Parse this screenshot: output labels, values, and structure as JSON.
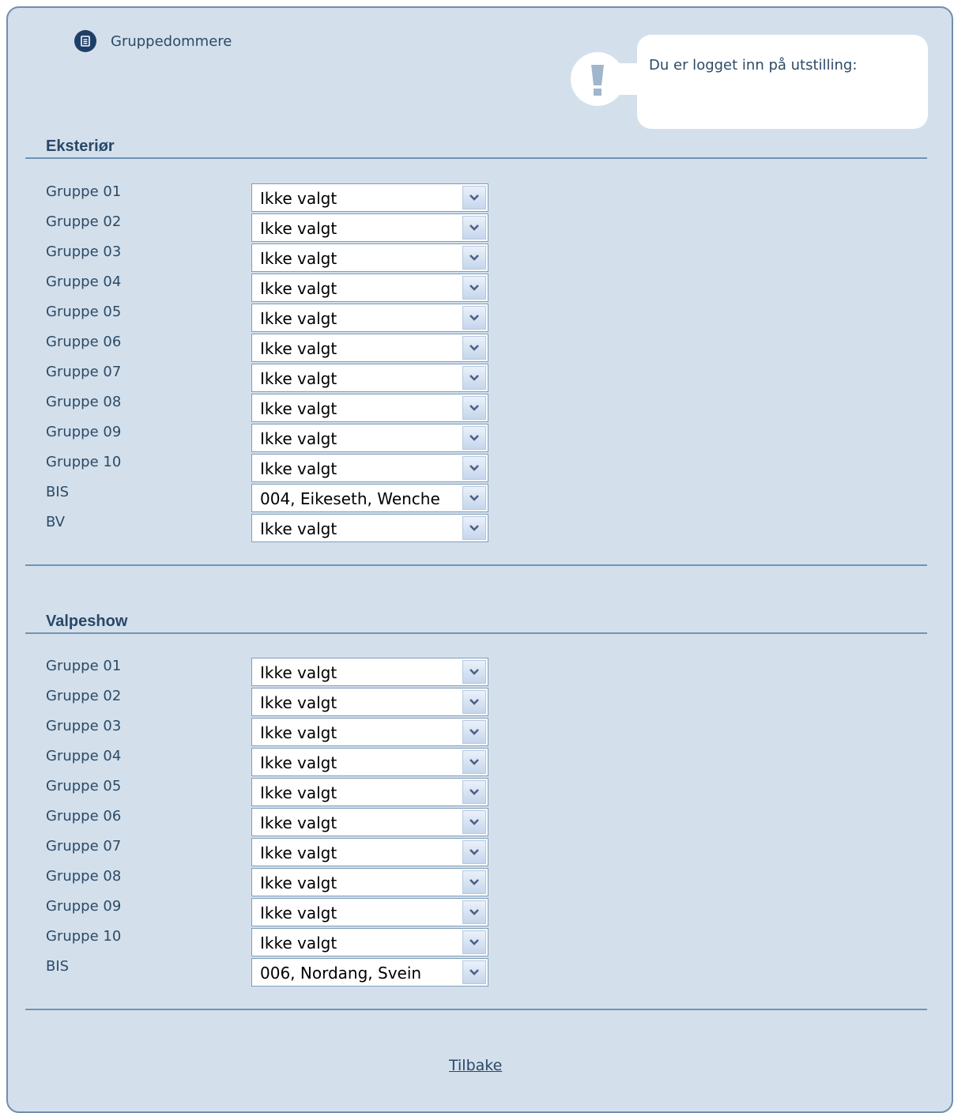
{
  "header": {
    "link_label": "Gruppedommere",
    "icon": "document-icon"
  },
  "notice": {
    "icon": "exclamation-icon",
    "text": "Du er logget inn på utstilling:"
  },
  "sections": [
    {
      "title": "Eksteriør",
      "rows": [
        {
          "label": "Gruppe 01",
          "value": "Ikke valgt"
        },
        {
          "label": "Gruppe 02",
          "value": "Ikke valgt"
        },
        {
          "label": "Gruppe 03",
          "value": "Ikke valgt"
        },
        {
          "label": "Gruppe 04",
          "value": "Ikke valgt"
        },
        {
          "label": "Gruppe 05",
          "value": "Ikke valgt"
        },
        {
          "label": "Gruppe 06",
          "value": "Ikke valgt"
        },
        {
          "label": "Gruppe 07",
          "value": "Ikke valgt"
        },
        {
          "label": "Gruppe 08",
          "value": "Ikke valgt"
        },
        {
          "label": "Gruppe 09",
          "value": "Ikke valgt"
        },
        {
          "label": "Gruppe 10",
          "value": "Ikke valgt"
        },
        {
          "label": "BIS",
          "value": "004, Eikeseth, Wenche"
        },
        {
          "label": "BV",
          "value": "Ikke valgt"
        }
      ]
    },
    {
      "title": "Valpeshow",
      "rows": [
        {
          "label": "Gruppe 01",
          "value": "Ikke valgt"
        },
        {
          "label": "Gruppe 02",
          "value": "Ikke valgt"
        },
        {
          "label": "Gruppe 03",
          "value": "Ikke valgt"
        },
        {
          "label": "Gruppe 04",
          "value": "Ikke valgt"
        },
        {
          "label": "Gruppe 05",
          "value": "Ikke valgt"
        },
        {
          "label": "Gruppe 06",
          "value": "Ikke valgt"
        },
        {
          "label": "Gruppe 07",
          "value": "Ikke valgt"
        },
        {
          "label": "Gruppe 08",
          "value": "Ikke valgt"
        },
        {
          "label": "Gruppe 09",
          "value": "Ikke valgt"
        },
        {
          "label": "Gruppe 10",
          "value": "Ikke valgt"
        },
        {
          "label": "BIS",
          "value": "006, Nordang, Svein"
        }
      ]
    }
  ],
  "footer": {
    "back_label": "Tilbake"
  }
}
